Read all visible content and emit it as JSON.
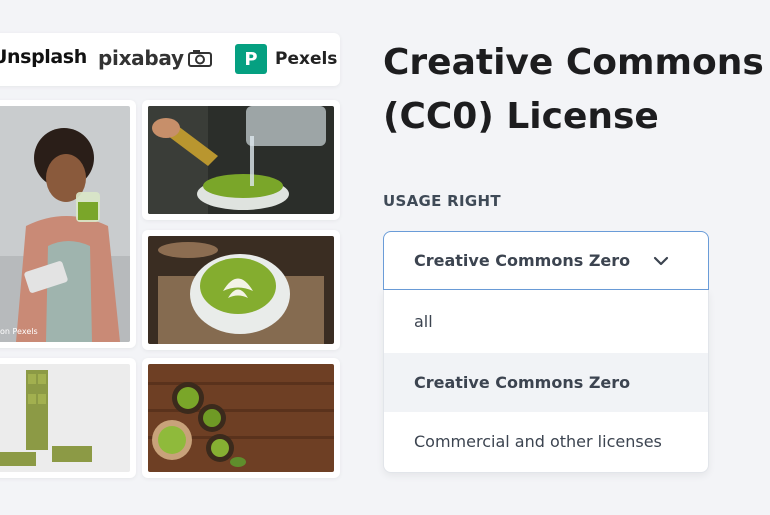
{
  "logos": {
    "unsplash": "Unsplash",
    "pixabay": "pixabay",
    "pexels": "Pexels",
    "pexels_mark": "P"
  },
  "photos": {
    "credit": "on Pexels"
  },
  "panel": {
    "title_line1": "Creative Commons Zero",
    "title_line2": "(CC0) License",
    "usage_label": "USAGE RIGHT"
  },
  "dropdown": {
    "selected": "Creative Commons Zero",
    "options": [
      {
        "label": "all"
      },
      {
        "label": "Creative Commons Zero"
      },
      {
        "label": "Commercial and other licenses"
      }
    ]
  },
  "colors": {
    "accent_border": "#6a9cd8",
    "pexels_green": "#05a081",
    "matcha": "#7aa629"
  }
}
